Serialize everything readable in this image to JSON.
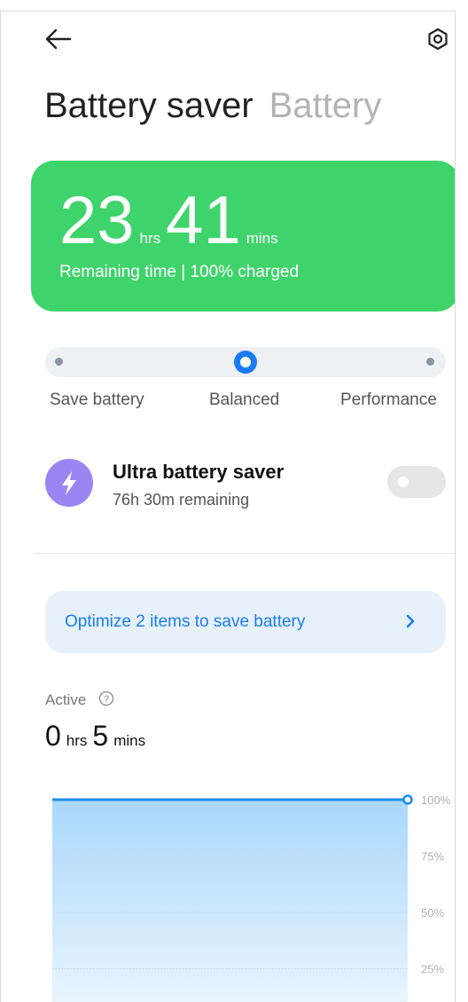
{
  "header": {
    "back_icon": "back-arrow-icon",
    "settings_icon": "settings-hexagon-icon"
  },
  "tabs": [
    {
      "label": "Battery saver",
      "active": true
    },
    {
      "label": "Battery",
      "active": false
    }
  ],
  "summary": {
    "hours": "23",
    "hours_unit": "hrs",
    "minutes": "41",
    "minutes_unit": "mins",
    "subtitle": "Remaining time | 100% charged",
    "color": "#3fd36b"
  },
  "modes": {
    "options": [
      "Save battery",
      "Balanced",
      "Performance"
    ],
    "selected": "Balanced",
    "accent": "#1a7cf5"
  },
  "ultra": {
    "icon": "lightning-bolt-icon",
    "title": "Ultra battery saver",
    "subtitle": "76h 30m remaining",
    "enabled": false,
    "icon_color": "#9a86f3"
  },
  "optimize": {
    "label": "Optimize 2 items to save battery",
    "icon": "chevron-right-icon"
  },
  "active": {
    "label": "Active",
    "help_icon": "question-circle-icon",
    "hours": "0",
    "hours_unit": "hrs",
    "minutes": "5",
    "minutes_unit": "mins"
  },
  "chart_data": {
    "type": "area",
    "y_ticks": [
      "100%",
      "75%",
      "50%",
      "25%"
    ],
    "series": [
      {
        "values": [
          100,
          100
        ]
      }
    ],
    "ylim": [
      0,
      100
    ],
    "grid": true,
    "color": "#1a8fe8"
  }
}
